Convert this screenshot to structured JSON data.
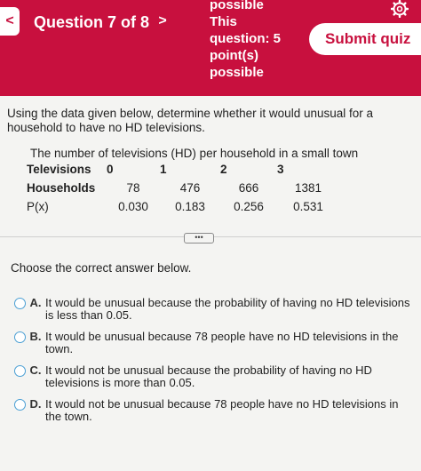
{
  "header": {
    "back_symbol": "<",
    "question_counter": "Question 7 of 8",
    "next_symbol": ">",
    "points_lines": [
      "possible",
      "This",
      "question: 5",
      "point(s)",
      "possible"
    ],
    "submit_label": "Submit quiz",
    "bg_color": "#c8103e"
  },
  "question": {
    "prompt": "Using the data given below, determine whether it would unusual for a household to have no HD televisions.",
    "table_caption": "The number of televisions (HD) per household in a small town",
    "table": {
      "headers": [
        "Televisions",
        "0",
        "1",
        "2",
        "3"
      ],
      "rows": [
        [
          "Households",
          "78",
          "476",
          "666",
          "1381"
        ],
        [
          "P(x)",
          "0.030",
          "0.183",
          "0.256",
          "0.531"
        ]
      ]
    },
    "more_button": "•••"
  },
  "answers": {
    "instruction": "Choose the correct answer below.",
    "options": [
      {
        "letter": "A.",
        "text": "It would be unusual because the probability of having no HD televisions is less than 0.05."
      },
      {
        "letter": "B.",
        "text": "It would be unusual because 78 people have no HD televisions in the town."
      },
      {
        "letter": "C.",
        "text": "It would not be unusual because the probability of having no HD televisions is more than 0.05."
      },
      {
        "letter": "D.",
        "text": "It would not be unusual because 78 people have no HD televisions in the town."
      }
    ]
  }
}
